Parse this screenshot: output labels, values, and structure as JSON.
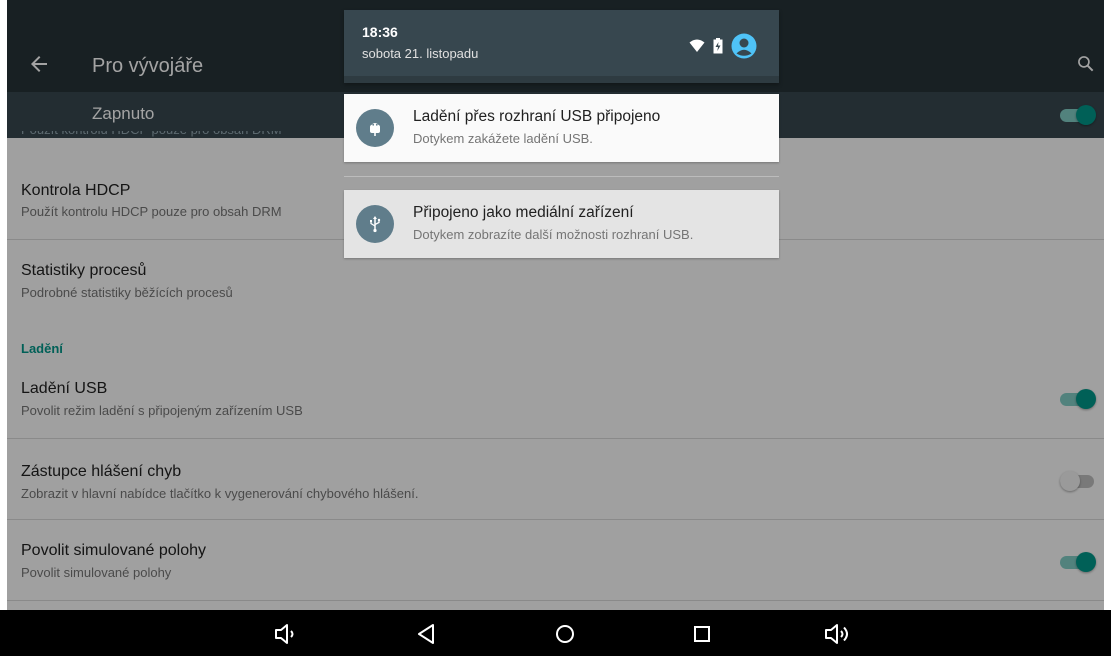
{
  "app_bar": {
    "title": "Pro vývojáře",
    "back_icon": "arrow-back-icon",
    "search_icon": "search-icon"
  },
  "master_switch": {
    "label": "Zapnuto",
    "state": "on"
  },
  "colors": {
    "app_bar": "#263238",
    "accent": "#009688",
    "notification_icon_bg": "#607d8b"
  },
  "settings": {
    "hdcp": {
      "title": "Kontrola HDCP",
      "summary": "Použít kontrolu HDCP pouze pro obsah DRM"
    },
    "process_stats": {
      "title": "Statistiky procesů",
      "summary": "Podrobné statistiky běžících procesů"
    },
    "section_debugging": "Ladění",
    "usb_debugging": {
      "title": "Ladění USB",
      "summary": "Povolit režim ladění s připojeným zařízením USB",
      "state": "on"
    },
    "bug_report": {
      "title": "Zástupce hlášení chyb",
      "summary": "Zobrazit v hlavní nabídce tlačítko k vygenerování chybového hlášení.",
      "state": "off"
    },
    "mock_locations": {
      "title": "Povolit simulované polohy",
      "summary": "Povolit simulované polohy",
      "state": "on"
    }
  },
  "shade": {
    "time": "18:36",
    "date": "sobota 21. listopadu",
    "status_icons": [
      "wifi-icon",
      "battery-charging-icon",
      "user-avatar-icon"
    ],
    "notifications": [
      {
        "icon": "android-debug-icon",
        "title": "Ladění přes rozhraní USB připojeno",
        "text": "Dotykem zakážete ladění USB."
      },
      {
        "icon": "usb-icon",
        "title": "Připojeno jako mediální zařízení",
        "text": "Dotykem zobrazíte další možnosti rozhraní USB."
      }
    ]
  },
  "nav_bar": {
    "buttons": [
      "volume-down-icon",
      "back-icon",
      "home-icon",
      "recents-icon",
      "volume-up-icon"
    ]
  }
}
